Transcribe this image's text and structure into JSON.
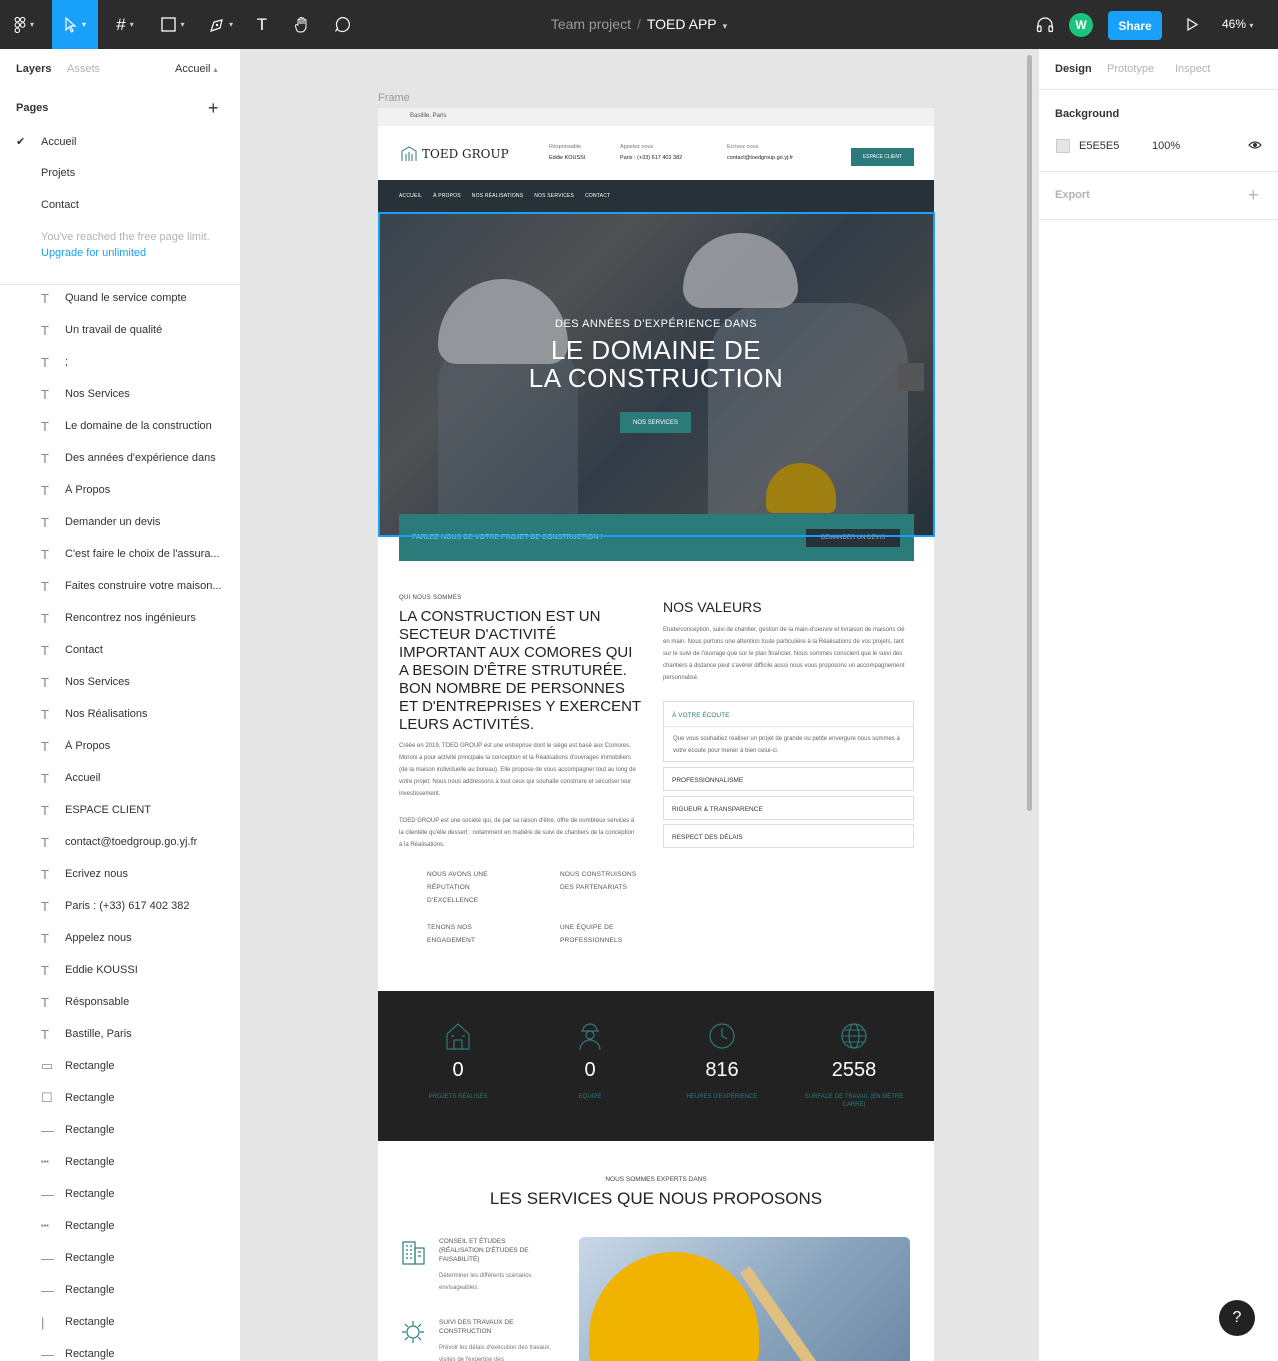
{
  "toolbar": {
    "file_team": "Team project",
    "file_sep": "/",
    "file_name": "TOED APP",
    "avatar_letter": "W",
    "share_label": "Share",
    "zoom": "46%"
  },
  "left_panel": {
    "tab_layers": "Layers",
    "tab_assets": "Assets",
    "current_page": "Accueil",
    "pages_title": "Pages",
    "pages": [
      "Accueil",
      "Projets",
      "Contact"
    ],
    "limit_note": "You've reached the free page limit.",
    "upgrade_link": "Upgrade for unlimited",
    "layers": [
      {
        "icon": "text",
        "name": "Quand le service compte"
      },
      {
        "icon": "text",
        "name": "Un travail de qualité"
      },
      {
        "icon": "text",
        "name": ";"
      },
      {
        "icon": "text",
        "name": "Nos Services"
      },
      {
        "icon": "text",
        "name": "Le domaine de la construction"
      },
      {
        "icon": "text",
        "name": "Des années d'expérience dans"
      },
      {
        "icon": "text",
        "name": "À Propos"
      },
      {
        "icon": "text",
        "name": "Demander un devis"
      },
      {
        "icon": "text",
        "name": "C'est faire le choix de l'assura..."
      },
      {
        "icon": "text",
        "name": "Faites construire votre maison..."
      },
      {
        "icon": "text",
        "name": "Rencontrez nos ingénieurs"
      },
      {
        "icon": "text",
        "name": "Contact"
      },
      {
        "icon": "text",
        "name": "Nos Services"
      },
      {
        "icon": "text",
        "name": "Nos Réalisations"
      },
      {
        "icon": "text",
        "name": "À Propos"
      },
      {
        "icon": "text",
        "name": "Accueil"
      },
      {
        "icon": "text",
        "name": "ESPACE CLIENT"
      },
      {
        "icon": "text",
        "name": "contact@toedgroup.go.yj.fr"
      },
      {
        "icon": "text",
        "name": "Ecrivez nous"
      },
      {
        "icon": "text",
        "name": "Paris : (+33) 617 402 382"
      },
      {
        "icon": "text",
        "name": "Appelez nous"
      },
      {
        "icon": "text",
        "name": "Eddie KOUSSI"
      },
      {
        "icon": "text",
        "name": "Résponsable"
      },
      {
        "icon": "text",
        "name": "Bastille, Paris"
      },
      {
        "icon": "rect-flat",
        "name": "Rectangle"
      },
      {
        "icon": "rect",
        "name": "Rectangle"
      },
      {
        "icon": "line",
        "name": "Rectangle"
      },
      {
        "icon": "line-dash",
        "name": "Rectangle"
      },
      {
        "icon": "line",
        "name": "Rectangle"
      },
      {
        "icon": "line-dash",
        "name": "Rectangle"
      },
      {
        "icon": "line",
        "name": "Rectangle"
      },
      {
        "icon": "line",
        "name": "Rectangle"
      },
      {
        "icon": "vline",
        "name": "Rectangle"
      },
      {
        "icon": "line",
        "name": "Rectangle"
      }
    ]
  },
  "canvas": {
    "frame_label": "Frame"
  },
  "site": {
    "top_location": "Bastille, Paris",
    "logo": "TOED GROUP",
    "header": [
      {
        "label": "Résponsable",
        "value": "Eddie KOUSSI"
      },
      {
        "label": "Appelez nous",
        "value": "Paris : (+33) 617 402 382"
      },
      {
        "label": "Ecrivez nous",
        "value": "contact@toedgroup.go.yj.fr"
      }
    ],
    "espace_client": "ESPACE CLIENT",
    "nav": [
      "ACCUEIL",
      "À PROPOS",
      "NOS RÉALISATIONS",
      "NOS SERVICES",
      "CONTACT"
    ],
    "hero": {
      "sub": "DES ANNÉES D'EXPÉRIENCE DANS",
      "title_line1": "LE DOMAINE DE",
      "title_line2": "LA CONSTRUCTION",
      "button": "NOS SERVICES"
    },
    "banner": {
      "text": "PARLEZ-NOUS DE VOTRE PROJET DE CONSTRUCTION !",
      "button": "DEMANDER UN DEVIS"
    },
    "about": {
      "label": "QUI NOUS SOMMES",
      "heading": "LA CONSTRUCTION EST UN SECTEUR D'ACTIVITÉ IMPORTANT AUX COMORES QUI A BESOIN D'ÊTRE STRUTURÉE. BON NOMBRE DE PERSONNES ET D'ENTREPRISES Y EXERCENT LEURS ACTIVITÉS.",
      "para1": "Créée en 2019, TOED GROUP est une entreprise dont le siège est basé aux Comores, Moroni a pour activité principale la conception et la Réalisations d'ouvrages immobiliers (de la maison individuelle au bureau). Elle propose de vous accompagner tout au long de votre projet. Nous nous addressons à tout ceux qui souhaite construire et sécuriser leur investissement.",
      "para2": "TOED GROUP est une société qui, de par sa raison d'être, offre de nombreux services à la clientèle qu'elle dessert : notamment en matière de suivi de chantiers de la conception à la Réalisations.",
      "features": [
        "NOUS AVONS UNE RÉPUTATION D'EXCELLENCE",
        "NOUS CONSTRUISONS DES PARTENARIATS",
        "TENONS NOS ENGAGEMENT",
        "UNE ÉQUIPE DE PROFESSIONNELS"
      ]
    },
    "values": {
      "heading": "NOS VALEURS",
      "para": "Etude/conception, suivi de chantier, gestion de la main-d'oeuvre et livraison de maisons clé en main. Nous portons une attention toute particulière à la Réalisations de vos projets, tant sur le suivi de l'ouvrage que sur le plan financier. Nous sommes conscient que le suivi des chantiers à distance peut s'avérer difficile aussi nous vous proposons un accompagnement personnalisé.",
      "items": [
        {
          "title": "À VOTRE ÉCOUTE",
          "desc": "Que vous souhaitiez réaliser un projet de grande ou petite envergure nous sommes à votre écoute pour mener à bien celui-ci."
        },
        {
          "title": "PROFESSIONNALISME",
          "desc": ""
        },
        {
          "title": "RIGUEUR & TRANSPARENCE",
          "desc": ""
        },
        {
          "title": "RESPECT DES DÉLAIS",
          "desc": ""
        }
      ]
    },
    "stats": [
      {
        "icon": "house-icon",
        "value": "0",
        "label": "PROJETS RÉALISÉS"
      },
      {
        "icon": "worker-icon",
        "value": "0",
        "label": "EQUIPE"
      },
      {
        "icon": "clock-icon",
        "value": "816",
        "label": "HEURES D'EXPÉRIENCE"
      },
      {
        "icon": "globe-icon",
        "value": "2558",
        "label": "SURFACE DE TRAVAIL (EN MÈTRE CARRÉ)"
      }
    ],
    "services": {
      "sub": "NOUS SOMMES EXPERTS DANS",
      "heading": "LES SERVICES QUE NOUS PROPOSONS",
      "items": [
        {
          "title": "CONSEIL ET ÉTUDES (RÉALISATION D'ÉTUDES DE FAISABILITÉ)",
          "desc": "Déterminer les différents scénarios envisageables."
        },
        {
          "title": "SUIVI DES TRAVAUX DE CONSTRUCTION",
          "desc": "Prévoir les délais d'exécution des travaux, visites de l'expertise des"
        }
      ]
    }
  },
  "right_panel": {
    "tab_design": "Design",
    "tab_prototype": "Prototype",
    "tab_inspect": "Inspect",
    "background_title": "Background",
    "background_hex": "E5E5E5",
    "background_opacity": "100%",
    "export_title": "Export"
  },
  "help": "?"
}
